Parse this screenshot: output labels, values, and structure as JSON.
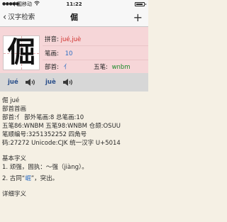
{
  "status": {
    "carrier": "中国移动",
    "time": "11:22",
    "battery_level": 0.9
  },
  "nav": {
    "back_label": "汉字检索",
    "title": "倔",
    "add_label": "+"
  },
  "header": {
    "character": "倔",
    "pinyin_label": "拼音:",
    "pinyin_value": "jué,juè",
    "strokes_label": "笔画:",
    "strokes_value": "10",
    "radical_label": "部首:",
    "radical_value": "亻",
    "wubi_label": "五笔:",
    "wubi_value": "wnbm"
  },
  "audio": {
    "items": [
      {
        "pron": "jué",
        "icon": "speaker-icon"
      },
      {
        "pron": "juè",
        "icon": "speaker-icon"
      }
    ]
  },
  "detail": {
    "lines": [
      "倔 jué",
      "部首首画",
      "部首:亻 部外笔画:8 总笔画:10",
      "五笔86:WNBM 五笔98:WNBM 仓颉:OSUU",
      "笔顺编号:3251352252  四角号",
      "码:27272 Unicode:CJK 统一汉字 U+5014"
    ],
    "basic_title": "基本字义",
    "basic_items": [
      "1. 顽强，固执：～强（jiàng）。",
      "2. 古同“",
      "”，突出。"
    ],
    "basic_link": "崛",
    "detail_title": "详细字义"
  },
  "colors": {
    "background": "#f5f0e4",
    "header_bg": "#f6d6d8",
    "audio_bg": "#d7d7d7",
    "pinyin_value": "#d0312d",
    "strokes_value": "#2f6fc4",
    "radical_value": "#2f6fc4",
    "wubi_value": "#1a8a2a",
    "link": "#2f6fc4"
  }
}
